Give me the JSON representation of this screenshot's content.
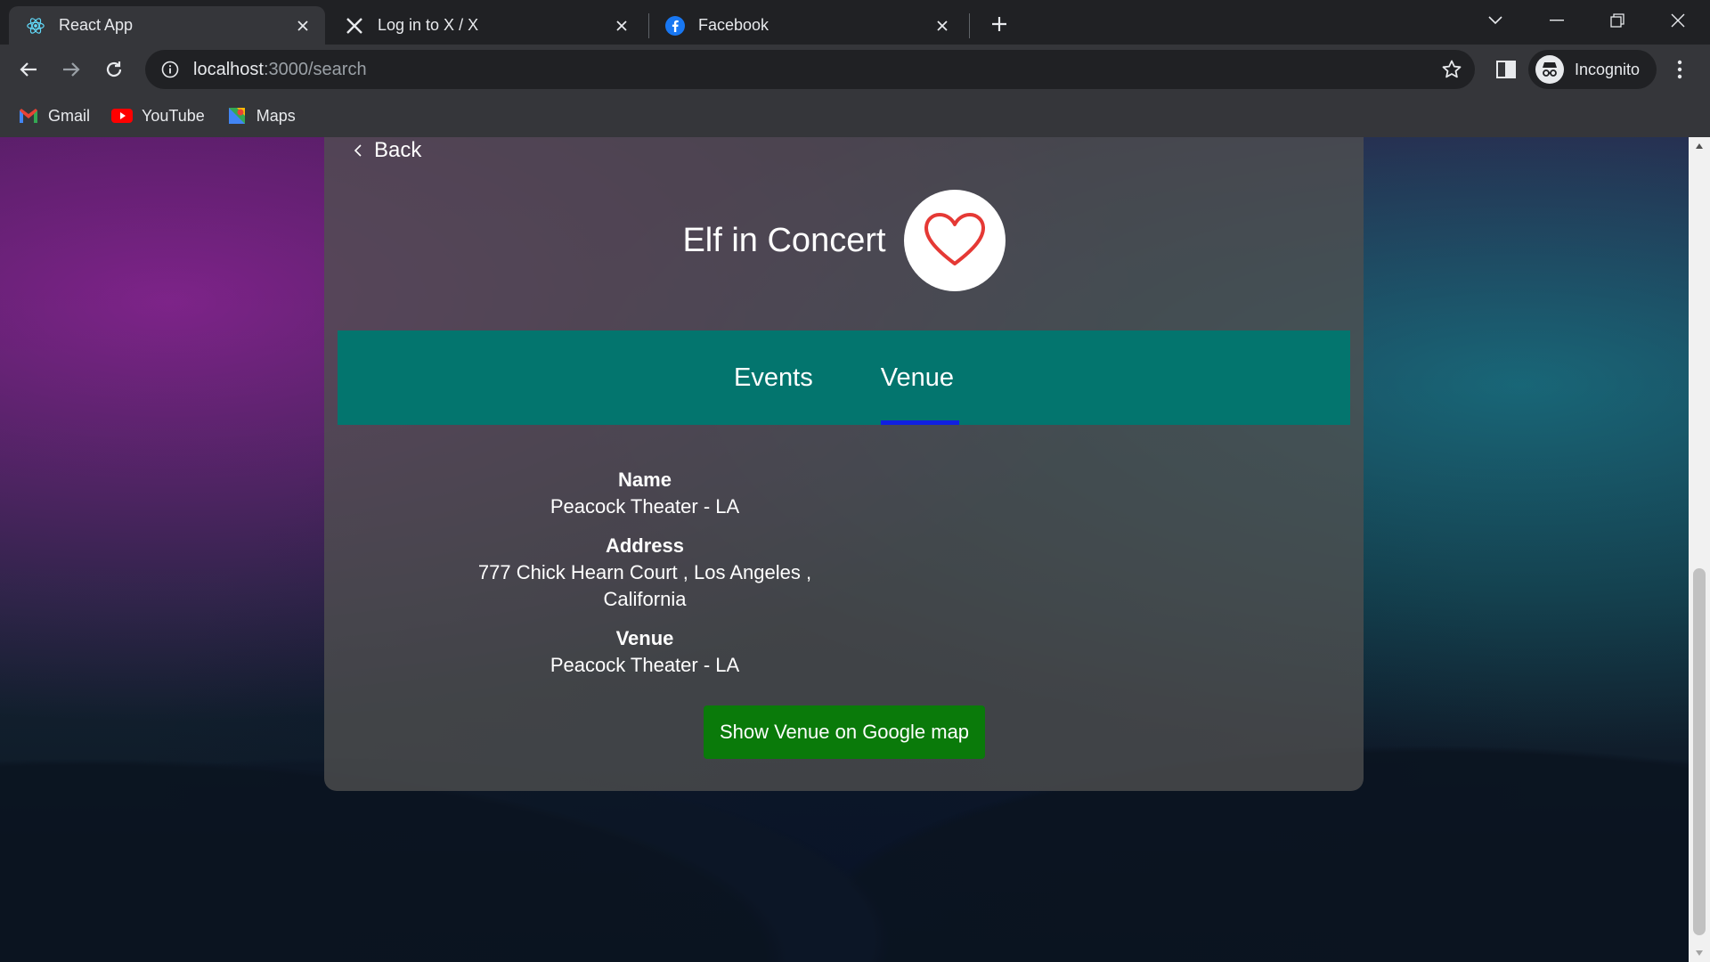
{
  "browser": {
    "tabs": [
      {
        "title": "React App",
        "icon": "react-icon",
        "active": true
      },
      {
        "title": "Log in to X / X",
        "icon": "x-logo-icon",
        "active": false
      },
      {
        "title": "Facebook",
        "icon": "facebook-icon",
        "active": false
      }
    ],
    "url_host": "localhost",
    "url_path": ":3000/search",
    "profile_label": "Incognito",
    "bookmarks": [
      {
        "label": "Gmail",
        "icon": "gmail-icon"
      },
      {
        "label": "YouTube",
        "icon": "youtube-icon"
      },
      {
        "label": "Maps",
        "icon": "maps-icon"
      }
    ]
  },
  "page": {
    "back_label": "Back",
    "artist_name": "Elf in Concert",
    "favorite_icon": "heart-icon",
    "tabs": [
      {
        "label": "Events",
        "selected": false
      },
      {
        "label": "Venue",
        "selected": true
      }
    ],
    "venue": {
      "name_label": "Name",
      "name_value": "Peacock Theater - LA",
      "address_label": "Address",
      "address_line1": "777 Chick Hearn Court , Los Angeles ,",
      "address_line2": "California",
      "venue_label": "Venue",
      "venue_value": "Peacock Theater - LA"
    },
    "map_button_label": "Show Venue on Google map"
  },
  "colors": {
    "tab_bar": "#03756e",
    "tab_indicator": "#1020e0",
    "map_button": "#0a7a0a",
    "heart": "#e53935"
  }
}
